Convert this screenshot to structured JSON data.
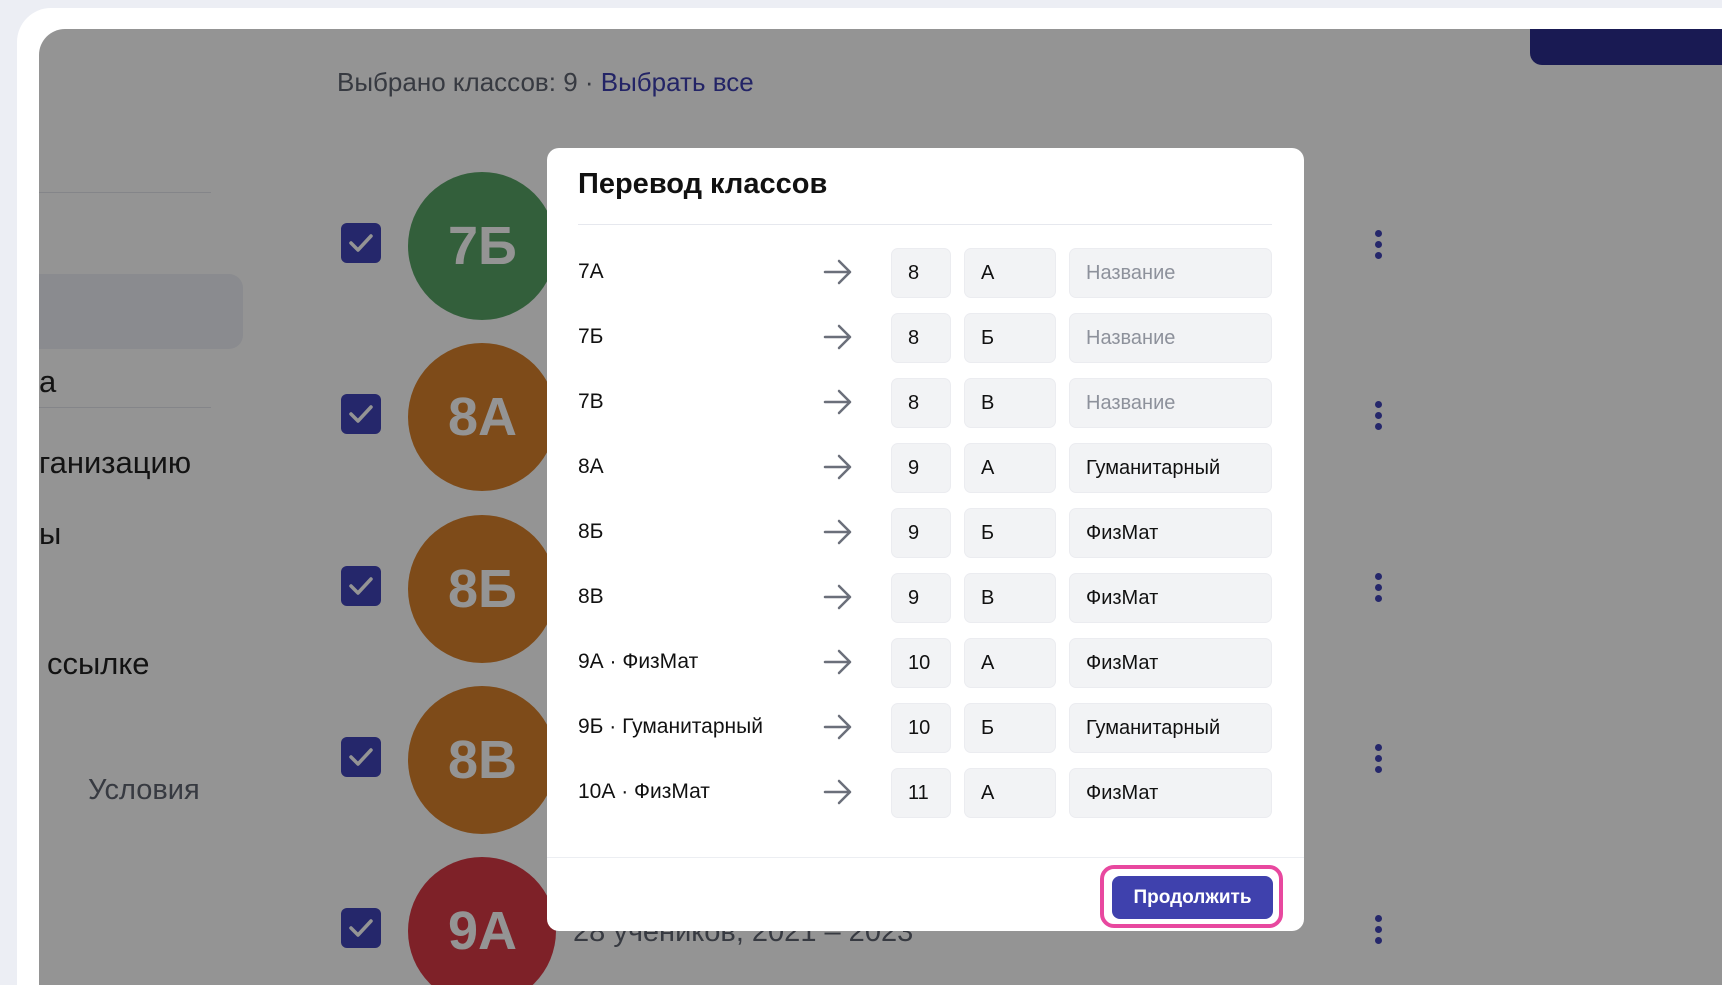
{
  "background": {
    "sidebar": {
      "items": [
        "а",
        "ганизацию",
        "ы",
        "ссылке"
      ],
      "terms_label": "Условия"
    },
    "header": {
      "selected_prefix": "Выбрано классов: 9",
      "separator": " · ",
      "select_all_label": "Выбрать все"
    },
    "class_rows": [
      {
        "avatar_text": "7Б",
        "color": "#58a466"
      },
      {
        "avatar_text": "8А",
        "color": "#d9822b"
      },
      {
        "avatar_text": "8Б",
        "color": "#d9822b"
      },
      {
        "avatar_text": "8В",
        "color": "#d9822b"
      },
      {
        "avatar_text": "9А",
        "color": "#d93a45",
        "subtitle": "28 учеников, 2021 – 2023"
      }
    ]
  },
  "modal": {
    "title": "Перевод классов",
    "rows": [
      {
        "source": "7А",
        "number": "8",
        "letter": "А",
        "name": "",
        "placeholder": "Название"
      },
      {
        "source": "7Б",
        "number": "8",
        "letter": "Б",
        "name": "",
        "placeholder": "Название"
      },
      {
        "source": "7В",
        "number": "8",
        "letter": "В",
        "name": "",
        "placeholder": "Название"
      },
      {
        "source": "8А",
        "number": "9",
        "letter": "А",
        "name": "Гуманитарный",
        "placeholder": "Название"
      },
      {
        "source": "8Б",
        "number": "9",
        "letter": "Б",
        "name": "ФизМат",
        "placeholder": "Название"
      },
      {
        "source": "8В",
        "number": "9",
        "letter": "В",
        "name": "ФизМат",
        "placeholder": "Название"
      },
      {
        "source": "9А · ФизМат",
        "number": "10",
        "letter": "А",
        "name": "ФизМат",
        "placeholder": "Название"
      },
      {
        "source": "9Б · Гуманитарный",
        "number": "10",
        "letter": "Б",
        "name": "Гуманитарный",
        "placeholder": "Название"
      },
      {
        "source": "10А · ФизМат",
        "number": "11",
        "letter": "А",
        "name": "ФизМат",
        "placeholder": "Название"
      }
    ],
    "continue_label": "Продолжить"
  },
  "colors": {
    "accent": "#3f41ad",
    "highlight": "#e8489f",
    "checkbox": "#4144b8"
  },
  "icons": {
    "arrow": "arrow-right-icon",
    "check": "checkmark-icon",
    "menu": "more-vertical-icon"
  }
}
